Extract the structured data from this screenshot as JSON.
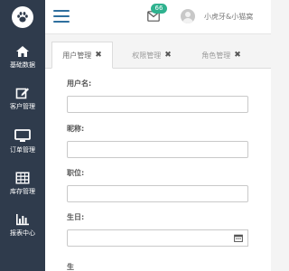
{
  "sidebar": {
    "logo_icon": "paw-icon",
    "items": [
      {
        "label": "基础数据",
        "icon": "home-icon"
      },
      {
        "label": "客户管理",
        "icon": "edit-icon"
      },
      {
        "label": "订单管理",
        "icon": "monitor-icon"
      },
      {
        "label": "库存管理",
        "icon": "grid-icon"
      },
      {
        "label": "报表中心",
        "icon": "bar-chart-icon"
      }
    ]
  },
  "topbar": {
    "menu_icon": "hamburger-icon",
    "notification_count": "66",
    "username": "小虎牙&小猫窝"
  },
  "tabs": [
    {
      "label": "用户管理",
      "close": "✖",
      "active": true
    },
    {
      "label": "权限管理",
      "close": "✖",
      "active": false
    },
    {
      "label": "角色管理",
      "close": "✖",
      "active": false
    }
  ],
  "form": {
    "username_label": "用户名:",
    "username_value": "",
    "nickname_label": "昵称:",
    "nickname_value": "",
    "job_label": "职位:",
    "job_value": "",
    "birthday_label": "生日:",
    "birthday_value": "",
    "partial_label": "生"
  },
  "colors": {
    "sidebar_bg": "#2f3b4c",
    "accent": "#2e6f9e",
    "badge": "#2fb28f"
  }
}
